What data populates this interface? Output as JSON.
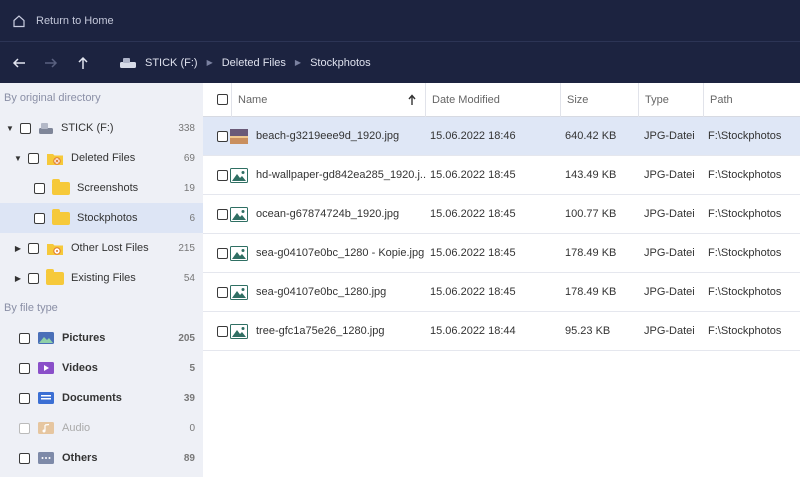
{
  "topbar": {
    "home_label": "Return to Home"
  },
  "breadcrumb": [
    "STICK (F:)",
    "Deleted Files",
    "Stockphotos"
  ],
  "sidebar": {
    "section_directory": "By original directory",
    "section_type": "By file type",
    "tree": [
      {
        "label": "STICK (F:)",
        "count": "338"
      },
      {
        "label": "Deleted Files",
        "count": "69"
      },
      {
        "label": "Screenshots",
        "count": "19"
      },
      {
        "label": "Stockphotos",
        "count": "6"
      },
      {
        "label": "Other Lost Files",
        "count": "215"
      },
      {
        "label": "Existing Files",
        "count": "54"
      }
    ],
    "types": [
      {
        "label": "Pictures",
        "count": "205"
      },
      {
        "label": "Videos",
        "count": "5"
      },
      {
        "label": "Documents",
        "count": "39"
      },
      {
        "label": "Audio",
        "count": "0"
      },
      {
        "label": "Others",
        "count": "89"
      }
    ]
  },
  "table": {
    "columns": [
      "Name",
      "Date Modified",
      "Size",
      "Type",
      "Path"
    ],
    "sort_icon": "arrow-up-icon",
    "rows": [
      {
        "name": "beach-g3219eee9d_1920.jpg",
        "date": "15.06.2022 18:46",
        "size": "640.42 KB",
        "type": "JPG-Datei",
        "path": "F:\\Stockphotos"
      },
      {
        "name": "hd-wallpaper-gd842ea285_1920.j...",
        "date": "15.06.2022 18:45",
        "size": "143.49 KB",
        "type": "JPG-Datei",
        "path": "F:\\Stockphotos"
      },
      {
        "name": "ocean-g67874724b_1920.jpg",
        "date": "15.06.2022 18:45",
        "size": "100.77 KB",
        "type": "JPG-Datei",
        "path": "F:\\Stockphotos"
      },
      {
        "name": "sea-g04107e0bc_1280 - Kopie.jpg",
        "date": "15.06.2022 18:45",
        "size": "178.49 KB",
        "type": "JPG-Datei",
        "path": "F:\\Stockphotos"
      },
      {
        "name": "sea-g04107e0bc_1280.jpg",
        "date": "15.06.2022 18:45",
        "size": "178.49 KB",
        "type": "JPG-Datei",
        "path": "F:\\Stockphotos"
      },
      {
        "name": "tree-gfc1a75e26_1280.jpg",
        "date": "15.06.2022 18:44",
        "size": "95.23 KB",
        "type": "JPG-Datei",
        "path": "F:\\Stockphotos"
      }
    ]
  },
  "colors": {
    "header_bg": "#1c2340",
    "sidebar_bg": "#eef0f6",
    "selected_bg": "#dfe7f6",
    "folder": "#f6c93a",
    "accent": "#3b6fd4"
  }
}
